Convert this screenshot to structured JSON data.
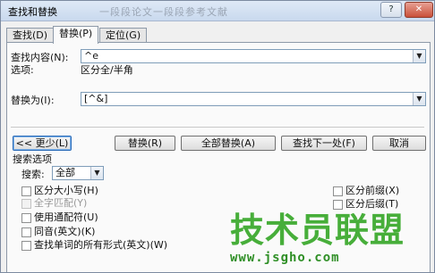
{
  "window": {
    "title": "查找和替换",
    "title_watermark": "一段段论文一段段参考文献",
    "help_label": "?",
    "close_label": "✕"
  },
  "tabs": [
    {
      "label": "查找(D)"
    },
    {
      "label": "替换(P)"
    },
    {
      "label": "定位(G)"
    }
  ],
  "find": {
    "label": "查找内容(N):",
    "value": "^e",
    "options_label": "选项:",
    "options_value": "区分全/半角"
  },
  "replace": {
    "label": "替换为(I):",
    "value": "[^&]"
  },
  "buttons": {
    "less": "<< 更少(L)",
    "replace": "替换(R)",
    "replace_all": "全部替换(A)",
    "find_next": "查找下一处(F)",
    "cancel": "取消"
  },
  "search_options": {
    "section_label": "搜索选项",
    "search_label": "搜索:",
    "search_value": "全部"
  },
  "checkboxes_left": [
    {
      "label": "区分大小写(H)",
      "disabled": false
    },
    {
      "label": "全字匹配(Y)",
      "disabled": true
    },
    {
      "label": "使用通配符(U)",
      "disabled": false
    },
    {
      "label": "同音(英文)(K)",
      "disabled": false
    },
    {
      "label": "查找单词的所有形式(英文)(W)",
      "disabled": false
    }
  ],
  "checkboxes_right": [
    {
      "label": "区分前缀(X)",
      "disabled": false
    },
    {
      "label": "区分后缀(T)",
      "disabled": false
    }
  ],
  "watermark": {
    "brand": "技术员联盟",
    "url": "www.jsgho.com"
  }
}
